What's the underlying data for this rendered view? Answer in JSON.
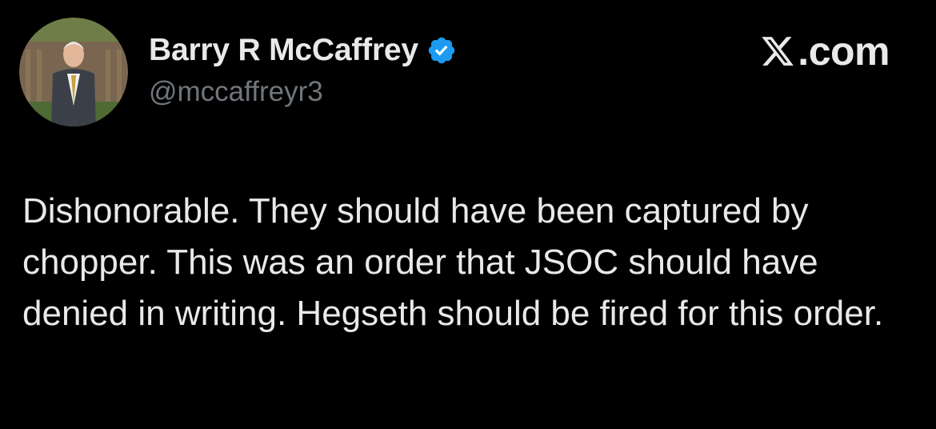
{
  "author": {
    "display_name": "Barry R McCaffrey",
    "handle": "@mccaffreyr3",
    "verified": true,
    "avatar_icon": "profile-photo-icon"
  },
  "brand": {
    "label": ".com",
    "icon": "x-logo-icon"
  },
  "tweet": {
    "text": "Dishonorable. They should have been captured by chopper. This was an order that JSOC should have denied in writing. Hegseth should be fired for this order."
  },
  "colors": {
    "background": "#000000",
    "primary_text": "#e7e9ea",
    "secondary_text": "#71767b",
    "verified_badge": "#1d9bf0"
  }
}
